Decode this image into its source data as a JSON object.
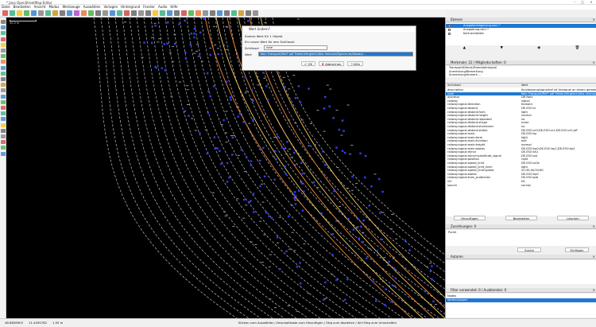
{
  "window": {
    "title": "* Java OpenStreetMap-Editor"
  },
  "menu": [
    "Datei",
    "Bearbeiten",
    "Ansicht",
    "Modus",
    "Werkzeuge",
    "Auswählen",
    "Vorlagen",
    "Hintergrund",
    "Fenster",
    "Audio",
    "Hilfe"
  ],
  "map": {
    "scale_label": "50.0 m"
  },
  "layers_panel": {
    "title": "Ebenen",
    "layers": [
      "Ausgabeinlagerung.osm *",
      "Ausgabung.osm *",
      "Kartuschbilder"
    ]
  },
  "selection_panel": {
    "title": "Merkmale: 22 / Mitgliedschaften: 0",
    "lines": [
      "Transport/Dienst/Eisenbahnsignal",
      "Anmerkung/Bemerkung",
      "Anmerkung/Anmerk ..."
    ]
  },
  "tags": {
    "header_key": "Schlüssel",
    "header_value": "Wert",
    "rows": [
      [
        "description",
        "Kurzfassung/signal/ref ist Vorsignal an einem gemeinsamen Mast"
      ],
      [
        "note",
        "Kein Transport/Ref? pdf Faktor/Vergleich/Abs Verbund/Spectrum/Absatz"
      ],
      [
        "operator",
        "DB Netz"
      ],
      [
        "railway",
        "signal"
      ],
      [
        "railway:signal:direction",
        "forward"
      ],
      [
        "railway:signal:distant",
        "DE-ESO:vr"
      ],
      [
        "railway:signal:distant:form",
        "light"
      ],
      [
        "railway:signal:distant:height",
        "normal"
      ],
      [
        "railway:signal:distant:repeated",
        "no"
      ],
      [
        "railway:signal:distant:shape",
        "mast"
      ],
      [
        "railway:signal:distant:shortened",
        "no"
      ],
      [
        "railway:signal:distant:states",
        "DE-ESO:vr0;DE-ESO:vr1;DE-ESO:vr2;off"
      ],
      [
        "railway:signal:main",
        "DE-ESO:hp"
      ],
      [
        "railway:signal:main:form",
        "light"
      ],
      [
        "railway:signal:main:function",
        "exit"
      ],
      [
        "railway:signal:main:height",
        "normal"
      ],
      [
        "railway:signal:main:states",
        "DE-ESO:hp0;DE-ESO:hp1;DE-ESO:hp2"
      ],
      [
        "railway:signal:minor",
        "DE-ESO:sh1"
      ],
      [
        "railway:signal:minor:substitute_signal",
        "DE-ESO:zs1"
      ],
      [
        "railway:signal:position",
        "right"
      ],
      [
        "railway:signal:speed_limit",
        "DE-ESO:zs3v"
      ],
      [
        "railway:signal:speed_limit_form",
        "light"
      ],
      [
        "railway:signal:speed_limit:speed",
        "20;30;40;50;60"
      ],
      [
        "railway:signal:states",
        "DE-ESO:hp0"
      ],
      [
        "railway:signal:train_protection",
        "DE-ESO:pzb"
      ],
      [
        "ref",
        "N1"
      ],
      [
        "source",
        "survey"
      ]
    ],
    "buttons": [
      "Hinzufügen",
      "Bearbeiten",
      "Löschen"
    ]
  },
  "relations_panel": {
    "title": "Zuordnungen: 0",
    "item": "Punkt",
    "buttons": [
      "Suche",
      "Einfügen"
    ]
  },
  "author_panel": {
    "title": "Autoren"
  },
  "filter_panel": {
    "title": "Filter verwendet: 0 / Ausblenden: 0",
    "rows": [
      "Nodes",
      "Verbindungen"
    ]
  },
  "dialog": {
    "title": "Wert ändern?",
    "line1": "Ändere Wert für 1 Objekt",
    "line2": "Ein neuer Wert für den Schlüssel:",
    "key_label": "Schlüssel",
    "key_value": "note",
    "value_label": "Wert",
    "value_text": "Kein Transport/Ref? pdf Faktor/Vergleich/Abs Verbund/Spectrum/Absatz/…",
    "ok": "OK",
    "cancel": "Abbrechen",
    "help": "Hilfe"
  },
  "status": {
    "coords": "48.8826903",
    "coords2": "11.4455762",
    "zoom": "1.55 m",
    "info": "Klicken zum Auswählen, Umschalttaste zum Hinzufügen / Strg zum Abziehen / Alt+Strg zum Umschalten"
  }
}
